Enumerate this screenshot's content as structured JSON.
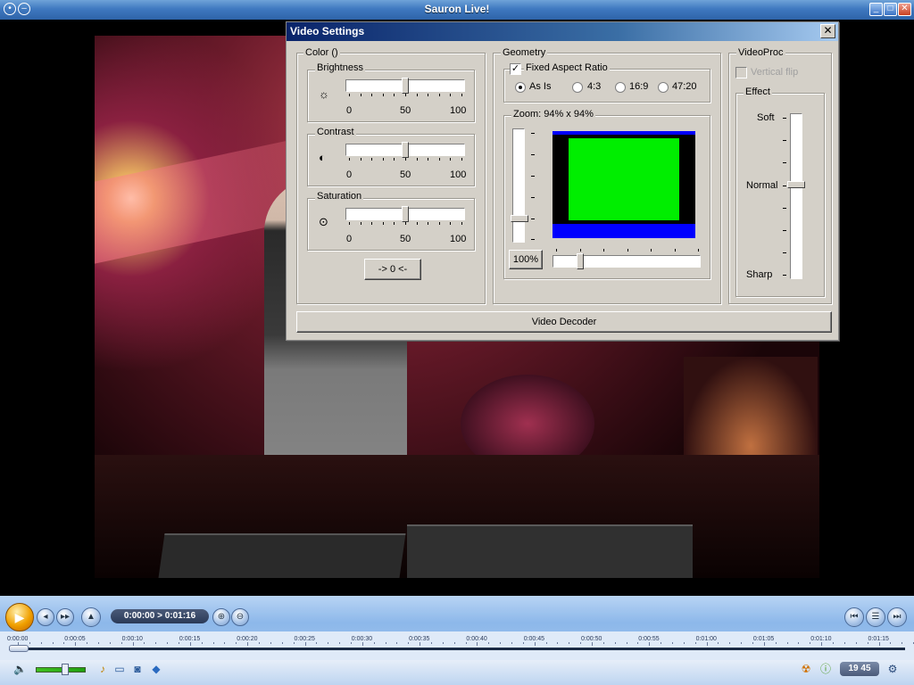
{
  "window": {
    "title": "Sauron Live!"
  },
  "dialog": {
    "title": "Video Settings",
    "close_label": "✕",
    "color_group": {
      "label": "Color ()",
      "brightness": {
        "label": "Brightness",
        "value": 50,
        "min_label": "0",
        "mid_label": "50",
        "max_label": "100",
        "icon": "sun-icon"
      },
      "contrast": {
        "label": "Contrast",
        "value": 50,
        "min_label": "0",
        "mid_label": "50",
        "max_label": "100",
        "icon": "contrast-icon"
      },
      "saturation": {
        "label": "Saturation",
        "value": 50,
        "min_label": "0",
        "mid_label": "50",
        "max_label": "100",
        "icon": "saturation-icon"
      },
      "reset_label": "-> 0 <-"
    },
    "geometry_group": {
      "label": "Geometry",
      "fixed_aspect_label": "Fixed Aspect Ratio",
      "fixed_aspect_checked": true,
      "aspect_options": [
        {
          "label": "As Is",
          "selected": true
        },
        {
          "label": "4:3",
          "selected": false
        },
        {
          "label": "16:9",
          "selected": false
        },
        {
          "label": "47:20",
          "selected": false
        }
      ],
      "zoom_label": "Zoom: 94% x 94%",
      "zoom_reset_label": "100%"
    },
    "videoproc_group": {
      "label": "VideoProc",
      "vertical_flip_label": "Vertical flip",
      "vertical_flip_checked": false,
      "effect_label": "Effect",
      "effect_soft": "Soft",
      "effect_normal": "Normal",
      "effect_sharp": "Sharp"
    },
    "decoder_button_label": "Video Decoder"
  },
  "player": {
    "time_display": "0:00:00 > 0:01:16",
    "clock": "19 45",
    "timeline_labels": [
      "0:00:00",
      "0:00:05",
      "0:00:10",
      "0:00:15",
      "0:00:20",
      "0:00:25",
      "0:00:30",
      "0:00:35",
      "0:00:40",
      "0:00:45",
      "0:00:50",
      "0:00:55",
      "0:01:00",
      "0:01:05",
      "0:01:10",
      "0:01:15"
    ],
    "progress": 0.0,
    "volume": 0.55,
    "colors": {
      "accent": "#f0a000",
      "bar": "#8db8ea"
    }
  }
}
